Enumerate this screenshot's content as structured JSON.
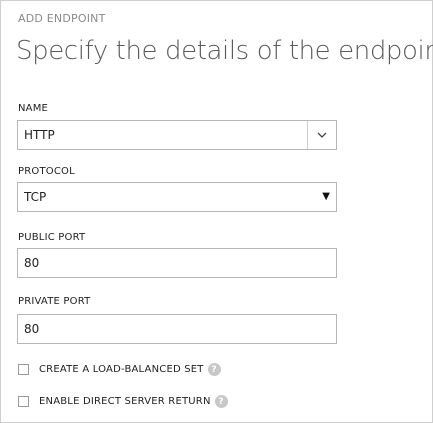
{
  "dialog": {
    "eyebrow": "ADD ENDPOINT",
    "title": "Specify the details of the endpoint"
  },
  "fields": {
    "name": {
      "label": "NAME",
      "value": "HTTP"
    },
    "protocol": {
      "label": "PROTOCOL",
      "value": "TCP"
    },
    "public_port": {
      "label": "PUBLIC PORT",
      "value": "80"
    },
    "private_port": {
      "label": "PRIVATE PORT",
      "value": "80"
    }
  },
  "options": {
    "load_balanced": {
      "label": "CREATE A LOAD-BALANCED SET",
      "checked": false
    },
    "direct_server_return": {
      "label": "ENABLE DIRECT SERVER RETURN",
      "checked": false
    }
  },
  "icons": {
    "combo": "chevron-down-icon",
    "select": "caret-down-icon",
    "help": "help-icon"
  }
}
